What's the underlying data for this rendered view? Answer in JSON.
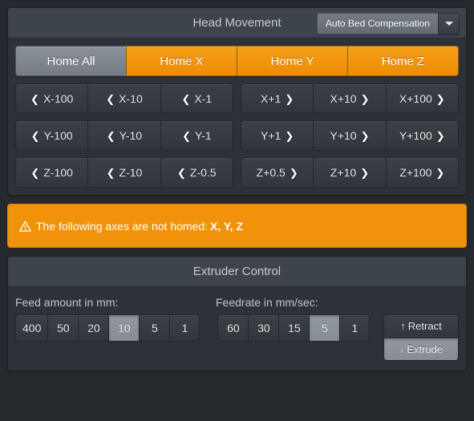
{
  "head_movement": {
    "title": "Head Movement",
    "compensation_button": {
      "label": "Auto Bed Compensation",
      "caret_icon": "chevron-down-icon"
    },
    "home_buttons": [
      {
        "label": "Home All",
        "style": "gray"
      },
      {
        "label": "Home X",
        "style": "orange"
      },
      {
        "label": "Home Y",
        "style": "orange"
      },
      {
        "label": "Home Z",
        "style": "orange"
      }
    ],
    "jog_rows": [
      {
        "minus": [
          {
            "label": "X-100",
            "icon": "chevron-left-icon",
            "glyph": "❮"
          },
          {
            "label": "X-10",
            "icon": "chevron-left-icon",
            "glyph": "❮"
          },
          {
            "label": "X-1",
            "icon": "chevron-left-icon",
            "glyph": "❮"
          }
        ],
        "plus": [
          {
            "label": "X+1",
            "icon": "chevron-right-icon",
            "glyph": "❯"
          },
          {
            "label": "X+10",
            "icon": "chevron-right-icon",
            "glyph": "❯"
          },
          {
            "label": "X+100",
            "icon": "chevron-right-icon",
            "glyph": "❯"
          }
        ]
      },
      {
        "minus": [
          {
            "label": "Y-100",
            "icon": "chevron-left-icon",
            "glyph": "❮"
          },
          {
            "label": "Y-10",
            "icon": "chevron-left-icon",
            "glyph": "❮"
          },
          {
            "label": "Y-1",
            "icon": "chevron-left-icon",
            "glyph": "❮"
          }
        ],
        "plus": [
          {
            "label": "Y+1",
            "icon": "chevron-right-icon",
            "glyph": "❯"
          },
          {
            "label": "Y+10",
            "icon": "chevron-right-icon",
            "glyph": "❯"
          },
          {
            "label": "Y+100",
            "icon": "chevron-right-icon",
            "glyph": "❯"
          }
        ]
      },
      {
        "minus": [
          {
            "label": "Z-100",
            "icon": "chevron-left-icon",
            "glyph": "❮"
          },
          {
            "label": "Z-10",
            "icon": "chevron-left-icon",
            "glyph": "❮"
          },
          {
            "label": "Z-0.5",
            "icon": "chevron-left-icon",
            "glyph": "❮"
          }
        ],
        "plus": [
          {
            "label": "Z+0.5",
            "icon": "chevron-right-icon",
            "glyph": "❯"
          },
          {
            "label": "Z+10",
            "icon": "chevron-right-icon",
            "glyph": "❯"
          },
          {
            "label": "Z+100",
            "icon": "chevron-right-icon",
            "glyph": "❯"
          }
        ]
      }
    ]
  },
  "alert": {
    "icon": "warning-triangle-icon",
    "message": "The following axes are not homed:",
    "axes": "X, Y, Z"
  },
  "extruder": {
    "title": "Extruder Control",
    "feed_label": "Feed amount in mm:",
    "feedrate_label": "Feedrate in mm/sec:",
    "feed_amounts": [
      "400",
      "50",
      "20",
      "10",
      "5",
      "1"
    ],
    "feed_selected": "10",
    "feedrates": [
      "60",
      "30",
      "15",
      "5",
      "1"
    ],
    "feedrate_selected": "5",
    "retract": {
      "label": "Retract",
      "icon": "arrow-up-icon",
      "glyph": "↑"
    },
    "extrude": {
      "label": "Extrude",
      "icon": "arrow-down-icon",
      "glyph": "↓"
    }
  },
  "colors": {
    "page_bg": "#25292e",
    "panel_bg": "#2d3239",
    "panel_head_bg": "#3e444c",
    "accent_orange": "#f0920a",
    "active_gray": "#8b9199"
  }
}
